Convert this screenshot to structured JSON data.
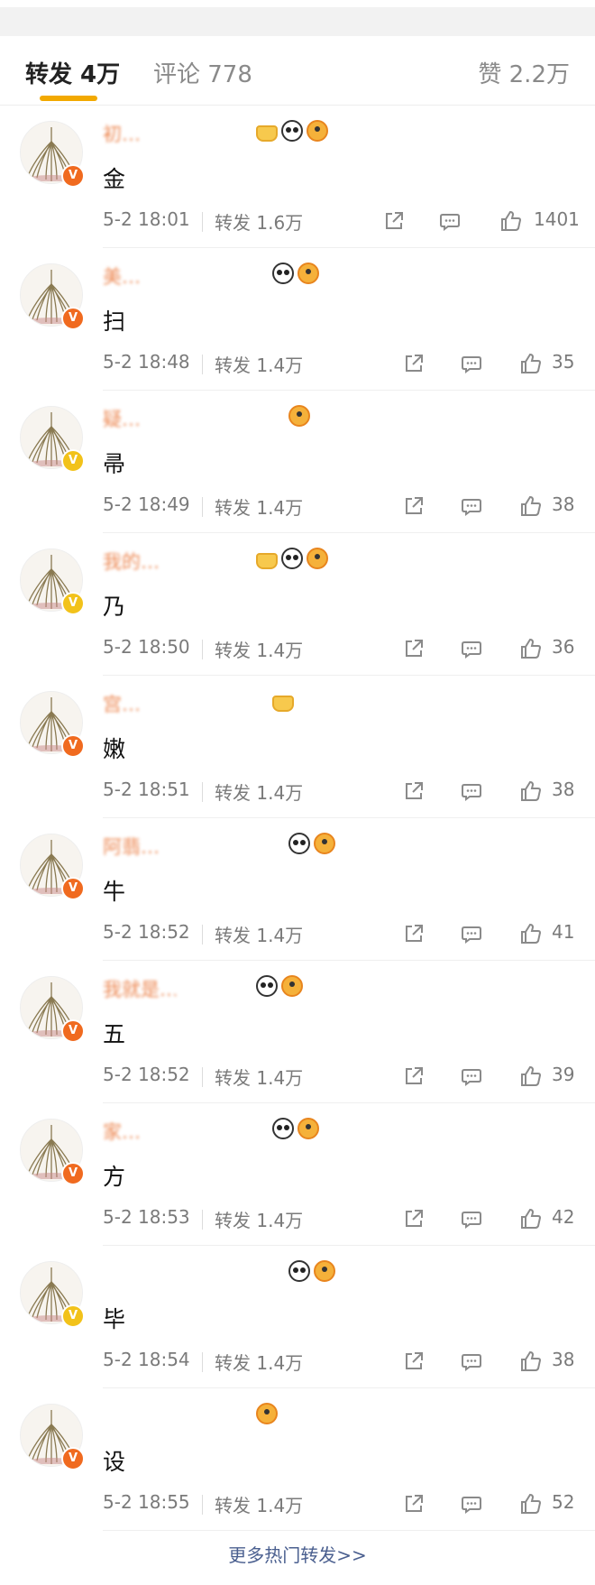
{
  "tabs": {
    "repost_label": "转发 4万",
    "comment_label": "评论 778",
    "like_label": "赞 2.2万"
  },
  "items": [
    {
      "name": "初…",
      "content": "金",
      "time": "5-2 18:01",
      "repost": "转发 1.6万",
      "likes": "1401",
      "badge": "orange"
    },
    {
      "name": "美…",
      "content": "扫",
      "time": "5-2 18:48",
      "repost": "转发 1.4万",
      "likes": "35",
      "badge": "orange"
    },
    {
      "name": "疑…",
      "content": "帚",
      "time": "5-2 18:49",
      "repost": "转发 1.4万",
      "likes": "38",
      "badge": "gold"
    },
    {
      "name": "我的…",
      "content": "乃",
      "time": "5-2 18:50",
      "repost": "转发 1.4万",
      "likes": "36",
      "badge": "gold"
    },
    {
      "name": "宫…",
      "content": "嫩",
      "time": "5-2 18:51",
      "repost": "转发 1.4万",
      "likes": "38",
      "badge": "orange"
    },
    {
      "name": "阿翡…",
      "content": "牛",
      "time": "5-2 18:52",
      "repost": "转发 1.4万",
      "likes": "41",
      "badge": "orange"
    },
    {
      "name": "我就是…",
      "content": "五",
      "time": "5-2 18:52",
      "repost": "转发 1.4万",
      "likes": "39",
      "badge": "orange"
    },
    {
      "name": "家…",
      "content": "方",
      "time": "5-2 18:53",
      "repost": "转发 1.4万",
      "likes": "42",
      "badge": "orange"
    },
    {
      "name": "",
      "content": "毕",
      "time": "5-2 18:54",
      "repost": "转发 1.4万",
      "likes": "38",
      "badge": "gold"
    },
    {
      "name": "",
      "content": "设",
      "time": "5-2 18:55",
      "repost": "转发 1.4万",
      "likes": "52",
      "badge": "orange"
    }
  ],
  "verified_mark": "V",
  "more_link": "更多热门转发>>",
  "colors": {
    "accent": "#f2a900",
    "link": "#4a5f8f",
    "badge_orange": "#f06a1f",
    "badge_gold": "#f2c21a"
  }
}
